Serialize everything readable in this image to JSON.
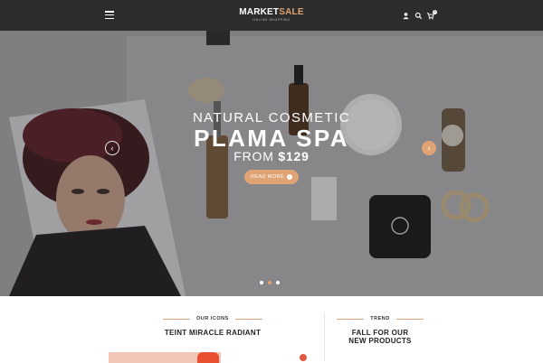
{
  "header": {
    "logo_main": "MARKET",
    "logo_accent": "SALE",
    "logo_tagline": "ONLINE SHOPPING",
    "icons": [
      "menu-icon",
      "user-icon",
      "search-icon",
      "cart-icon"
    ],
    "cart_count": "0"
  },
  "slider": {
    "line1": "NATURAL COSMETIC",
    "line2": "PLAMA SPA",
    "line3_prefix": "FROM ",
    "line3_price": "$129",
    "button_label": "READ MORE",
    "button_icon": "arrow-right-icon",
    "prev_label": "‹",
    "next_label": "›",
    "slide_count": 3,
    "active_slide": 2
  },
  "sections": {
    "left": {
      "kicker": "OUR ICONS",
      "title": "TEINT MIRACLE RADIANT"
    },
    "right": {
      "kicker": "TREND",
      "title_line1": "FALL FOR OUR",
      "title_line2": "NEW PRODUCTS"
    }
  },
  "colors": {
    "accent": "#e0a374",
    "topbar": "#161618",
    "text_dark": "#222222",
    "badge": "#e25a43"
  }
}
